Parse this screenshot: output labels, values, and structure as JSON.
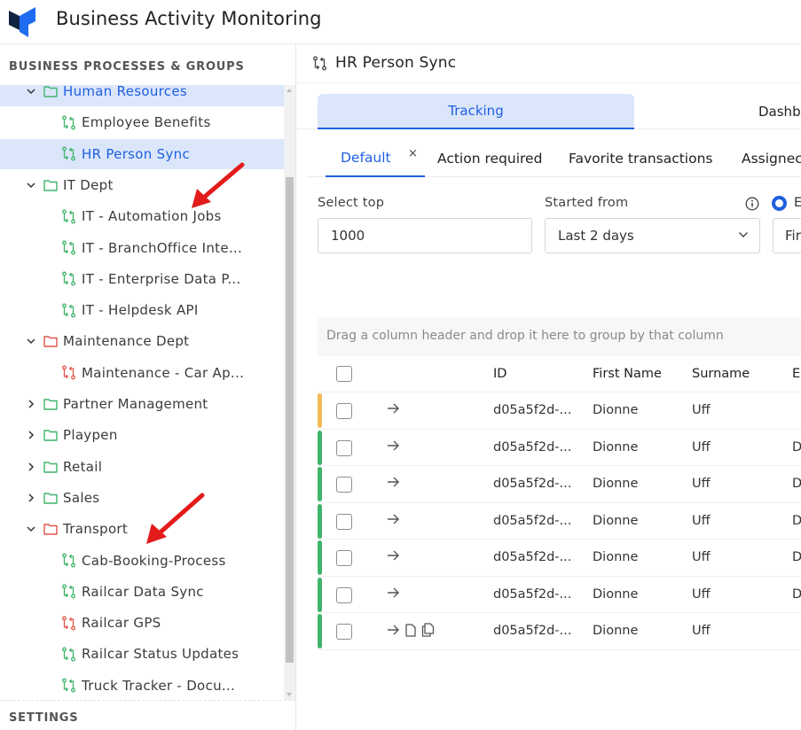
{
  "app": {
    "title": "Business Activity Monitoring",
    "brand_colors": {
      "dark": "#0f2340",
      "blue": "#1f6cf0"
    }
  },
  "sidebar": {
    "heading": "BUSINESS PROCESSES & GROUPS",
    "footer": "SETTINGS",
    "tree": [
      {
        "type": "group",
        "label": "Human Resources",
        "expanded": true,
        "status": "ok",
        "selected_group": true
      },
      {
        "type": "process",
        "label": "Employee Benefits",
        "status": "ok"
      },
      {
        "type": "process",
        "label": "HR Person Sync",
        "status": "ok",
        "selected": true
      },
      {
        "type": "group",
        "label": "IT Dept",
        "expanded": true,
        "status": "ok"
      },
      {
        "type": "process",
        "label": "IT - Automation Jobs",
        "status": "ok"
      },
      {
        "type": "process",
        "label": "IT - BranchOffice Inte...",
        "status": "ok"
      },
      {
        "type": "process",
        "label": "IT - Enterprise Data P...",
        "status": "ok"
      },
      {
        "type": "process",
        "label": "IT - Helpdesk API",
        "status": "ok"
      },
      {
        "type": "group",
        "label": "Maintenance Dept",
        "expanded": true,
        "status": "error"
      },
      {
        "type": "process",
        "label": "Maintenance - Car Ap...",
        "status": "error"
      },
      {
        "type": "group",
        "label": "Partner Management",
        "expanded": false,
        "status": "ok"
      },
      {
        "type": "group",
        "label": "Playpen",
        "expanded": false,
        "status": "ok"
      },
      {
        "type": "group",
        "label": "Retail",
        "expanded": false,
        "status": "ok"
      },
      {
        "type": "group",
        "label": "Sales",
        "expanded": false,
        "status": "ok"
      },
      {
        "type": "group",
        "label": "Transport",
        "expanded": true,
        "status": "error"
      },
      {
        "type": "process",
        "label": "Cab-Booking-Process",
        "status": "ok"
      },
      {
        "type": "process",
        "label": "Railcar Data Sync",
        "status": "ok"
      },
      {
        "type": "process",
        "label": "Railcar GPS",
        "status": "error"
      },
      {
        "type": "process",
        "label": "Railcar Status Updates",
        "status": "ok"
      },
      {
        "type": "process",
        "label": "Truck Tracker - Docu...",
        "status": "ok"
      }
    ],
    "status_colors": {
      "ok": "#3fb46a",
      "error": "#e2554b"
    }
  },
  "main": {
    "page_title": "HR Person Sync",
    "tabs": [
      {
        "label": "Tracking",
        "active": true
      },
      {
        "label": "Dashb"
      }
    ],
    "sub_tabs": [
      {
        "label": "Default",
        "active": true,
        "closable": true
      },
      {
        "label": "Action required"
      },
      {
        "label": "Favorite transactions"
      },
      {
        "label": "Assignec"
      }
    ],
    "close_glyph": "×",
    "filters": {
      "select_top": {
        "label": "Select top",
        "value": "1000"
      },
      "started_from": {
        "label": "Started from",
        "value": "Last 2 days"
      },
      "radio_label": "E",
      "third_field_value": "Fir"
    },
    "group_bar_text": "Drag a column header and drop it here to group by that column",
    "grid": {
      "columns": [
        "ID",
        "First Name",
        "Surname",
        "E"
      ],
      "rows": [
        {
          "status": "warning",
          "id": "d05a5f2d-...",
          "first_name": "Dionne",
          "surname": "Uff",
          "extra": "",
          "has_docs": false
        },
        {
          "status": "ok",
          "id": "d05a5f2d-...",
          "first_name": "Dionne",
          "surname": "Uff",
          "extra": "D",
          "has_docs": false
        },
        {
          "status": "ok",
          "id": "d05a5f2d-...",
          "first_name": "Dionne",
          "surname": "Uff",
          "extra": "D",
          "has_docs": false
        },
        {
          "status": "ok",
          "id": "d05a5f2d-...",
          "first_name": "Dionne",
          "surname": "Uff",
          "extra": "D",
          "has_docs": false
        },
        {
          "status": "ok",
          "id": "d05a5f2d-...",
          "first_name": "Dionne",
          "surname": "Uff",
          "extra": "D",
          "has_docs": false
        },
        {
          "status": "ok",
          "id": "d05a5f2d-...",
          "first_name": "Dionne",
          "surname": "Uff",
          "extra": "D",
          "has_docs": false
        },
        {
          "status": "ok",
          "id": "d05a5f2d-...",
          "first_name": "Dionne",
          "surname": "Uff",
          "extra": "",
          "has_docs": true
        }
      ],
      "row_status_colors": {
        "ok": "#3fb46a",
        "warning": "#f3b957"
      }
    },
    "accent_color": "#1f5fe0"
  }
}
